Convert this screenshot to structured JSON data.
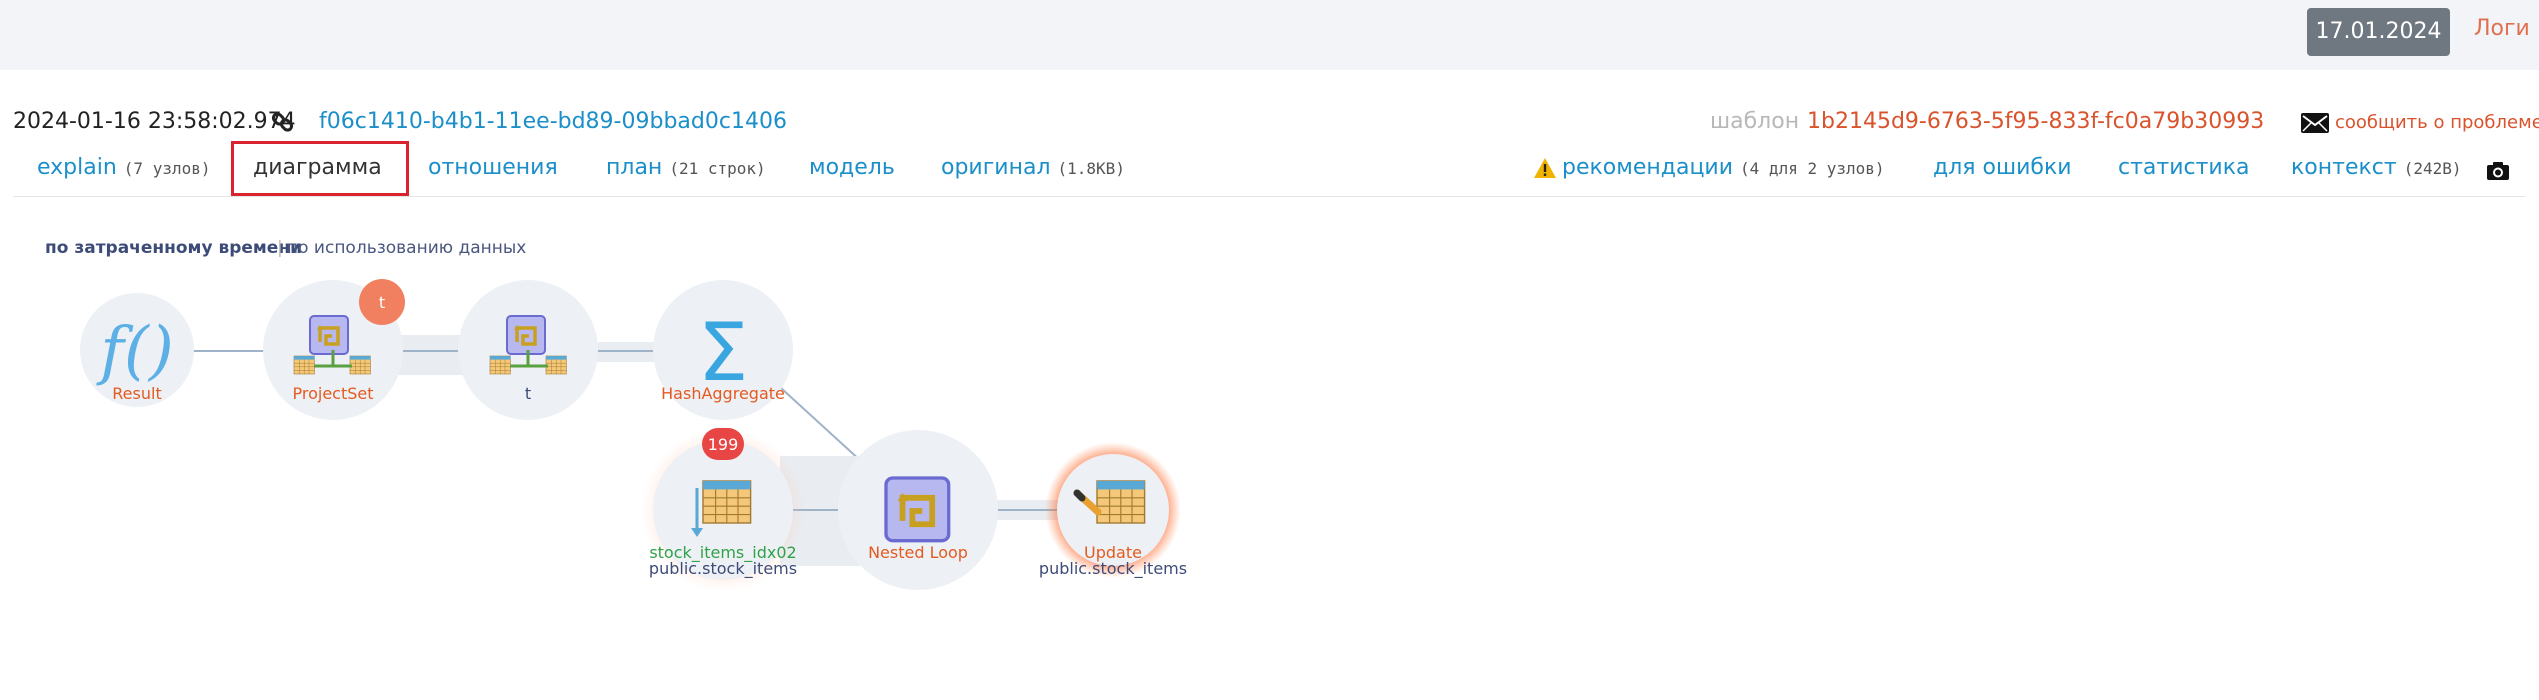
{
  "header": {
    "date_badge": "17.01.2024",
    "logs_link": "Логи"
  },
  "info": {
    "timestamp": "2024-01-16 23:58:02.974",
    "guid": "f06c1410-b4b1-11ee-bd89-09bbad0c1406",
    "template_label": "шаблон",
    "template_id": "1b2145d9-6763-5f95-833f-fc0a79b30993",
    "report_link": "сообщить о проблеме"
  },
  "tabs": {
    "explain": {
      "label": "explain",
      "count": "(7 узлов)"
    },
    "diagram": {
      "label": "диаграмма"
    },
    "relations": {
      "label": "отношения"
    },
    "plan": {
      "label": "план",
      "count": "(21 строк)"
    },
    "model": {
      "label": "модель"
    },
    "original": {
      "label": "оригинал",
      "count": "(1.8KB)"
    },
    "recommendations": {
      "label": "рекомендации",
      "count": "(4 для 2 узлов)"
    },
    "for_error": {
      "label": "для ошибки"
    },
    "statistics": {
      "label": "статистика"
    },
    "context": {
      "label": "контекст",
      "count": "(242B)"
    }
  },
  "mode": {
    "primary": "по затраченному времени",
    "separator": "|",
    "secondary": "по использованию данных"
  },
  "nodes": {
    "result": {
      "label": "Result"
    },
    "projectset": {
      "label": "ProjectSet",
      "badge": "t"
    },
    "t": {
      "label": "t"
    },
    "hashaggregate": {
      "label": "HashAggregate"
    },
    "index": {
      "label": "stock_items_idx02",
      "sublabel": "public.stock_items",
      "badge": "199"
    },
    "nestedloop": {
      "label": "Nested Loop"
    },
    "update": {
      "label": "Update",
      "sublabel": "public.stock_items"
    }
  },
  "colors": {
    "accent_link": "#1b8fc9",
    "accent_orange": "#d9532c",
    "active_tab_border": "#d9232e",
    "badge_orange": "#f08060",
    "badge_red": "#e84545"
  },
  "icons": {
    "link": "link-icon",
    "mail": "mail-icon",
    "warning": "warning-icon",
    "camera": "camera-icon"
  }
}
